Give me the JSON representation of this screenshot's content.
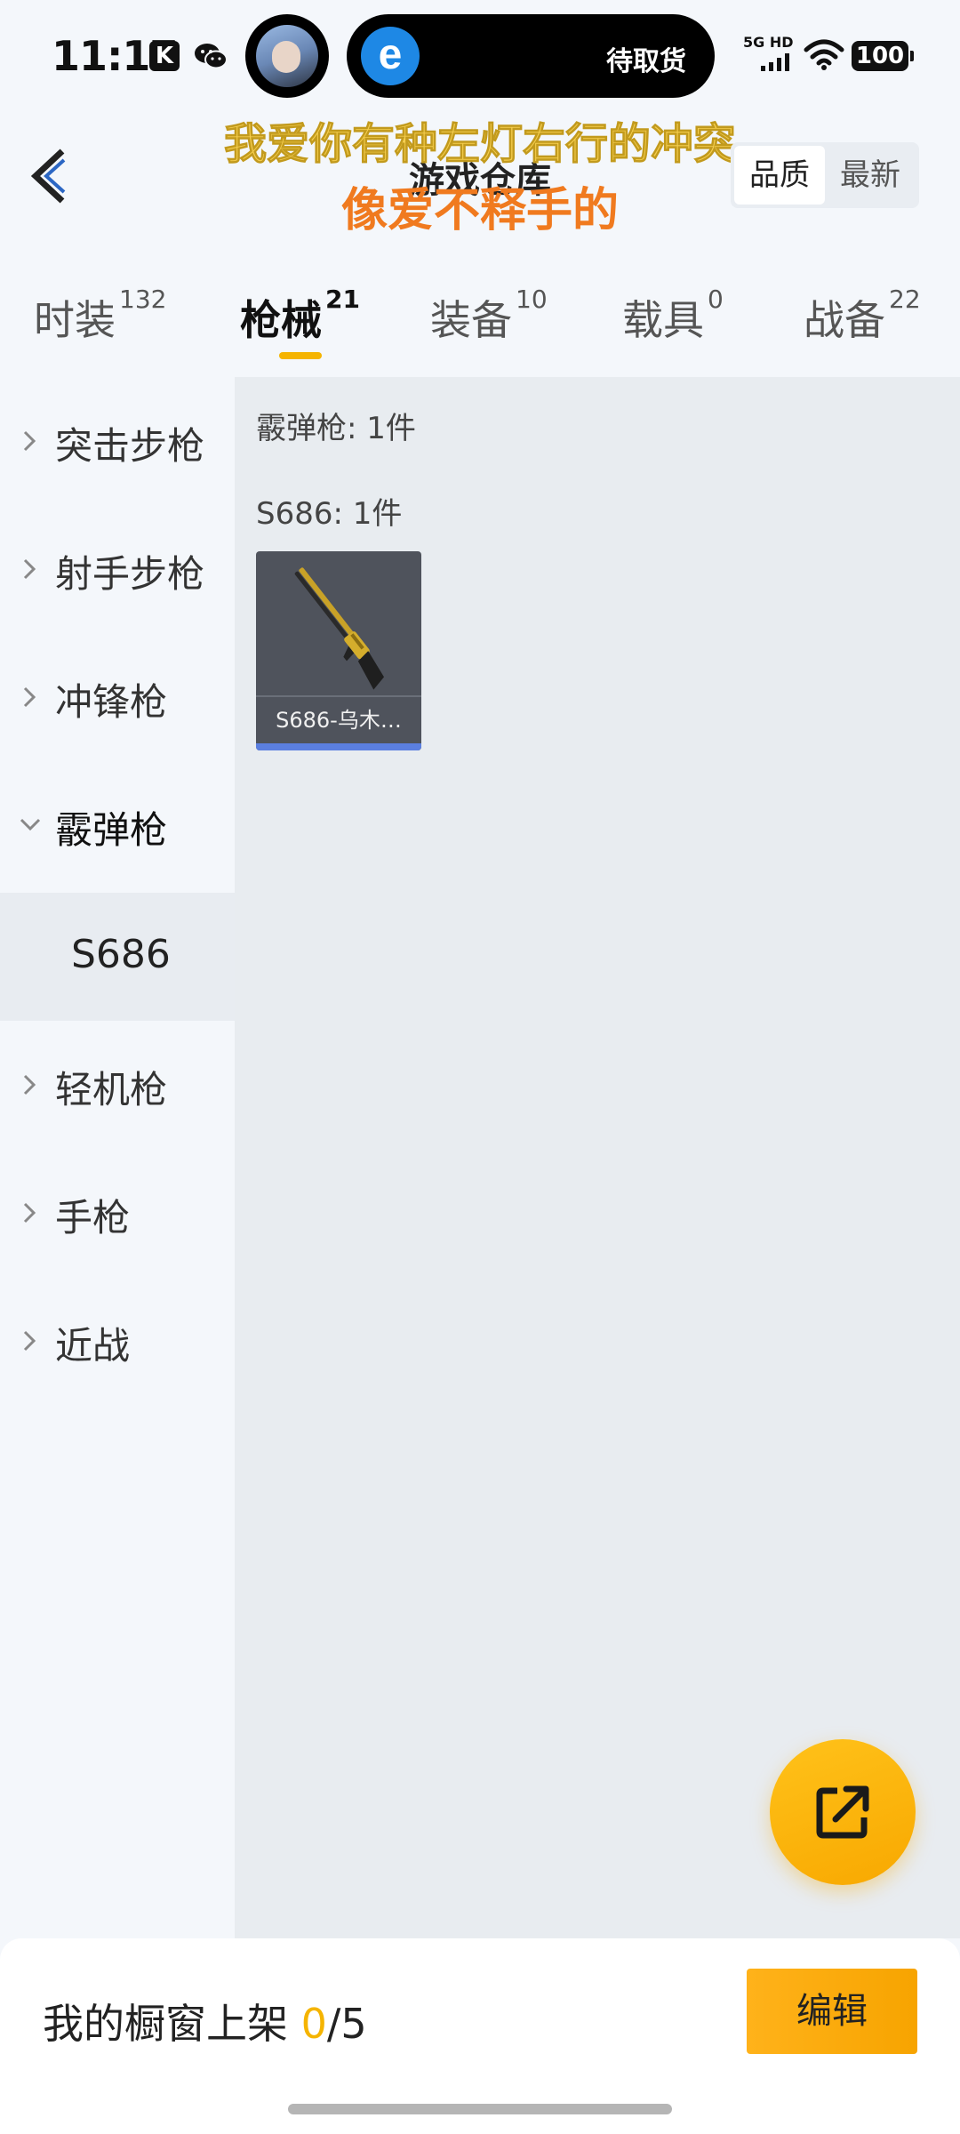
{
  "status_bar": {
    "time": "11:17",
    "k_icon_text": "K",
    "island_text": "待取货",
    "network": "5G HD",
    "battery": "100"
  },
  "header": {
    "title": "游戏仓库",
    "lyric_line1": "我爱你有种左灯右行的冲突",
    "lyric_line2": "像爱不释手的",
    "sort_options": [
      "品质",
      "最新"
    ],
    "sort_active": "品质"
  },
  "tabs": [
    {
      "label": "时装",
      "count": "132"
    },
    {
      "label": "枪械",
      "count": "21"
    },
    {
      "label": "装备",
      "count": "10"
    },
    {
      "label": "载具",
      "count": "0"
    },
    {
      "label": "战备",
      "count": "22"
    }
  ],
  "active_tab": "枪械",
  "sidebar": {
    "items": [
      {
        "label": "突击步枪"
      },
      {
        "label": "射手步枪"
      },
      {
        "label": "冲锋枪"
      },
      {
        "label": "霰弹枪"
      },
      {
        "label": "轻机枪"
      },
      {
        "label": "手枪"
      },
      {
        "label": "近战"
      }
    ],
    "expanded": "霰弹枪",
    "sub_item": "S686"
  },
  "main": {
    "category_head": "霰弹枪: 1件",
    "subcategory_head": "S686: 1件",
    "items": [
      {
        "name": "S686-乌木…",
        "rarity_color": "#5b7fe0"
      }
    ]
  },
  "bottom_bar": {
    "showcase_label": "我的橱窗上架",
    "showcase_count": "0",
    "showcase_total": "/5",
    "edit_label": "编辑"
  },
  "colors": {
    "accent": "#f5b400",
    "lyric_yellow": "#f6cf4f",
    "lyric_orange": "#f07a1f"
  },
  "icons": [
    "back-arrow-icon",
    "chevron-right-icon",
    "chevron-down-icon",
    "share-icon",
    "wechat-icon",
    "wifi-icon",
    "signal-icon",
    "eleme-icon"
  ]
}
